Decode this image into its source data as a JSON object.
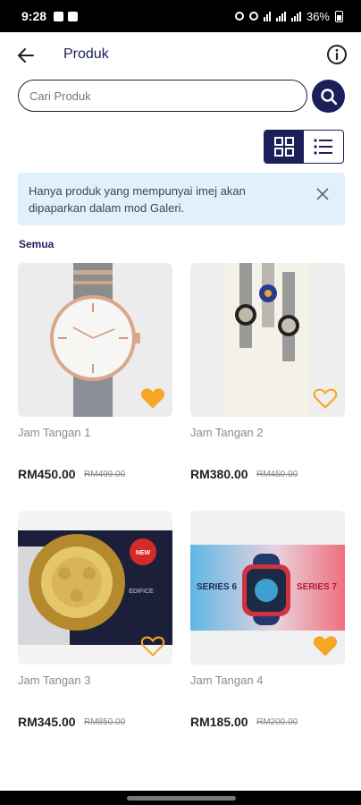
{
  "status": {
    "time": "9:28",
    "battery": "36%"
  },
  "header": {
    "title": "Produk"
  },
  "search": {
    "placeholder": "Cari Produk"
  },
  "view": {
    "selected": "grid"
  },
  "notice": {
    "text": "Hanya produk yang mempunyai imej akan dipaparkan dalam mod Galeri."
  },
  "section": {
    "label": "Semua"
  },
  "colors": {
    "primary": "#1b1f5a",
    "accent": "#f5a623",
    "notice_bg": "#e1f1fb"
  },
  "products": [
    {
      "name": "Jam Tangan 1",
      "price": "RM450.00",
      "old_price": "RM499.00",
      "favorited": true
    },
    {
      "name": "Jam Tangan 2",
      "price": "RM380.00",
      "old_price": "RM450.00",
      "favorited": false
    },
    {
      "name": "Jam Tangan 3",
      "price": "RM345.00",
      "old_price": "RM850.00",
      "favorited": false
    },
    {
      "name": "Jam Tangan 4",
      "price": "RM185.00",
      "old_price": "RM200.00",
      "favorited": true,
      "banner_left": "SERIES 6",
      "banner_right": "SERIES 7"
    }
  ]
}
